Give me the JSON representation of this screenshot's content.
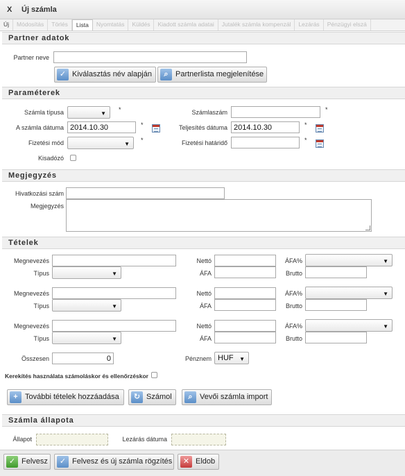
{
  "window": {
    "close_label": "X",
    "title": "Új számla"
  },
  "tabs": [
    {
      "label": "Új",
      "state": "enabled"
    },
    {
      "label": "Módosítás",
      "state": "disabled"
    },
    {
      "label": "Törlés",
      "state": "disabled"
    },
    {
      "label": "Lista",
      "state": "active"
    },
    {
      "label": "Nyomtatás",
      "state": "disabled"
    },
    {
      "label": "Küldés",
      "state": "disabled"
    },
    {
      "label": "Kiadott számla adatai",
      "state": "disabled"
    },
    {
      "label": "Jutalék számla kompenzál",
      "state": "disabled"
    },
    {
      "label": "Lezárás",
      "state": "disabled"
    },
    {
      "label": "Pénzügyi elszá",
      "state": "disabled"
    }
  ],
  "partner": {
    "heading": "Partner adatok",
    "name_label": "Partner neve",
    "name_value": "",
    "select_by_name_button": "Kiválasztás név alapján",
    "show_list_button": "Partnerlista megjelenítése"
  },
  "params": {
    "heading": "Paraméterek",
    "invoice_type_label": "Számla típusa",
    "invoice_type_value": "",
    "invoice_number_label": "Számlaszám",
    "invoice_number_value": "",
    "invoice_date_label": "A számla dátuma",
    "invoice_date_value": "2014.10.30",
    "fulfillment_date_label": "Teljesítés dátuma",
    "fulfillment_date_value": "2014.10.30",
    "payment_method_label": "Fizetési mód",
    "payment_method_value": "",
    "payment_deadline_label": "Fizetési határidő",
    "payment_deadline_value": "",
    "issuer_label": "Kisadózó",
    "required_mark": "*"
  },
  "notes": {
    "heading": "Megjegyzés",
    "reference_label": "Hivatkozási szám",
    "reference_value": "",
    "note_label": "Megjegyzés",
    "note_value": ""
  },
  "items": {
    "heading": "Tételek",
    "name_label": "Megnevezés",
    "type_label": "Típus",
    "net_label": "Nettó",
    "vat_label": "ÁFA",
    "vat_pct_label": "ÁFA%",
    "gross_label": "Brutto",
    "rows": [
      {
        "name": "",
        "type": "",
        "net": "",
        "vat": "",
        "vat_pct": "",
        "gross": ""
      },
      {
        "name": "",
        "type": "",
        "net": "",
        "vat": "",
        "vat_pct": "",
        "gross": ""
      },
      {
        "name": "",
        "type": "",
        "net": "",
        "vat": "",
        "vat_pct": "",
        "gross": ""
      }
    ],
    "total_label": "Összesen",
    "total_value": "0",
    "currency_label": "Pénznem",
    "currency_value": "HUF",
    "rounding_label": "Kerekítés használata számoláskor és ellenőrzéskor",
    "add_items_button": "További tételek hozzáadása",
    "calculate_button": "Számol",
    "import_button": "Vevői számla import"
  },
  "status": {
    "heading": "Számla állapota",
    "state_label": "Állapot",
    "state_value": "",
    "closing_date_label": "Lezárás dátuma",
    "closing_date_value": ""
  },
  "footer": {
    "save_button": "Felvesz",
    "save_new_button": "Felvesz és új számla rögzítés",
    "discard_button": "Eldob"
  },
  "icons": {
    "check": "check-icon",
    "search": "search-icon",
    "plus": "plus-icon",
    "refresh": "refresh-icon",
    "close": "close-icon",
    "calendar": "calendar-icon"
  }
}
